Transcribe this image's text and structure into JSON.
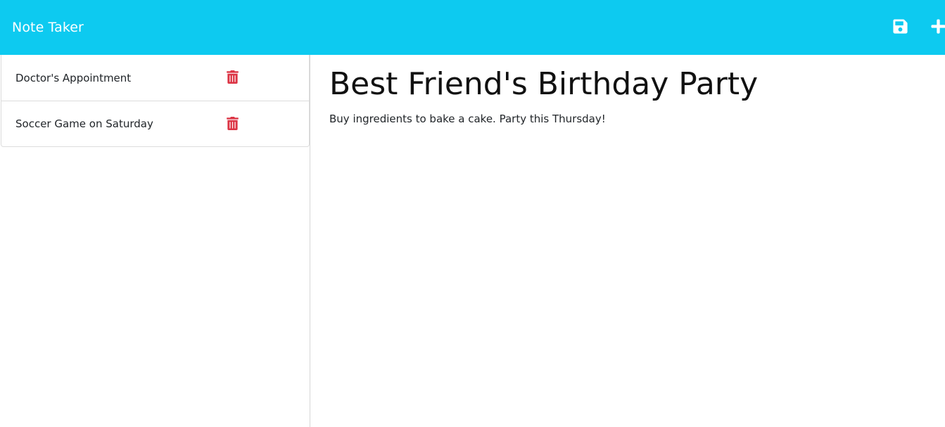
{
  "app": {
    "title": "Note Taker"
  },
  "toolbar": {
    "save_icon": "save-icon",
    "new_icon": "plus-icon"
  },
  "notes": [
    {
      "title": "Doctor's Appointment"
    },
    {
      "title": "Soccer Game on Saturday"
    }
  ],
  "active_note": {
    "title": "Best Friend's Birthday Party",
    "text": "Buy ingredients to bake a cake. Party this Thursday!"
  },
  "colors": {
    "navbar": "#0dcaf0",
    "delete": "#dc3545",
    "nav_text": "#ffffff"
  }
}
